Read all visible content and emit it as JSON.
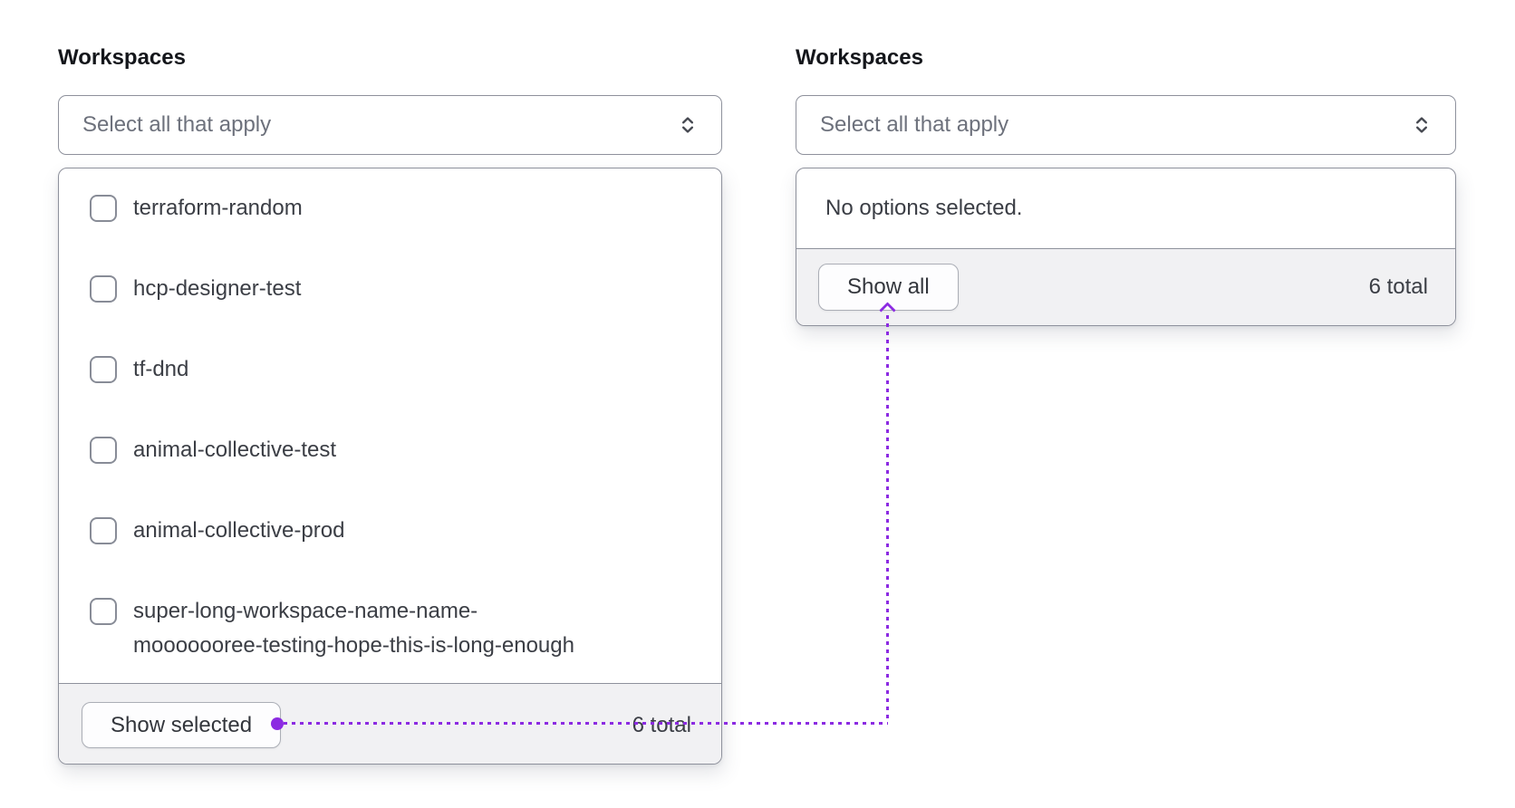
{
  "colors": {
    "accent": "#8c2be2",
    "border": "#8e919c",
    "footer_bg": "#f1f1f3",
    "text": "#3b3e45",
    "placeholder": "#6d717c"
  },
  "left_select": {
    "label": "Workspaces",
    "placeholder": "Select all that apply",
    "caret_icon": "caret-sort-icon",
    "options": [
      "terraform-random",
      "hcp-designer-test",
      "tf-dnd",
      "animal-collective-test",
      "animal-collective-prod",
      "super-long-workspace-name-name-mooooooree-testing-hope-this-is-long-enough"
    ],
    "footer": {
      "show_button": "Show selected",
      "total": "6 total"
    }
  },
  "right_select": {
    "label": "Workspaces",
    "placeholder": "Select all that apply",
    "caret_icon": "caret-sort-icon",
    "empty_message": "No options selected.",
    "footer": {
      "show_button": "Show all",
      "total": "6 total"
    }
  }
}
